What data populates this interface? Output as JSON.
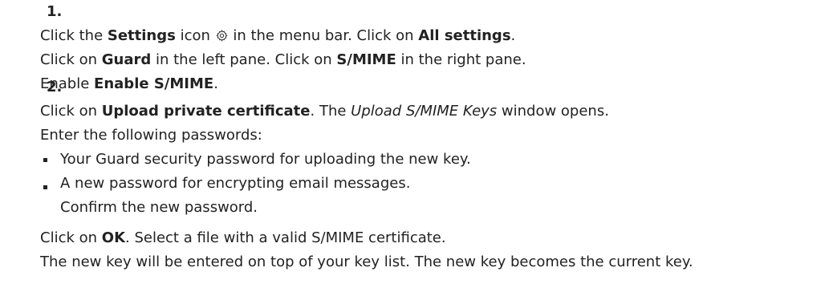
{
  "steps": [
    {
      "number": "1.",
      "lines": [
        {
          "a": "Click the ",
          "b": "Settings",
          "c": " icon ",
          "d": " in the menu bar. Click on ",
          "e": "All settings",
          "f": "."
        },
        {
          "a": "Click on ",
          "b": "Guard",
          "c": " in the left pane. Click on ",
          "d": "S/MIME",
          "e": " in the right pane."
        },
        {
          "a": "Enable ",
          "b": "Enable S/MIME",
          "c": "."
        }
      ]
    },
    {
      "number": "2.",
      "line1": {
        "a": "Click on ",
        "b": "Upload private certificate",
        "c": ". The ",
        "d": "Upload S/MIME Keys",
        "e": " window opens."
      },
      "line2": "Enter the following passwords:",
      "bullets": [
        {
          "text": "Your Guard security password for uploading the new key."
        },
        {
          "text": "A new password for encrypting email messages.",
          "text2": "Confirm the new password."
        }
      ],
      "line3": {
        "a": "Click on ",
        "b": "OK",
        "c": ". Select a file with a valid S/MIME certificate."
      },
      "line4": "The new key will be entered on top of your key list. The new key becomes the current key."
    }
  ],
  "icons": {
    "settings": "gear-icon"
  }
}
